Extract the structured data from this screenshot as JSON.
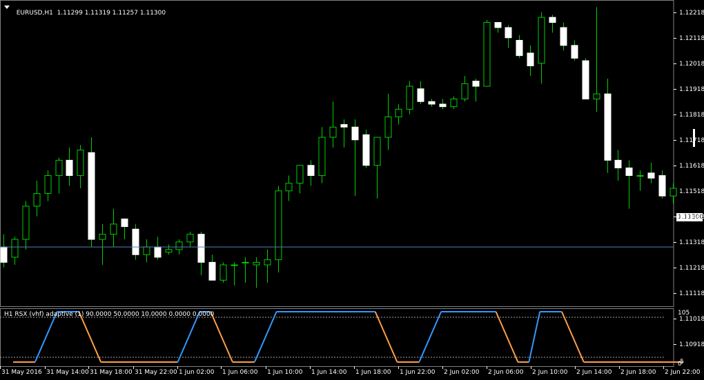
{
  "header": {
    "symbol": "EURUSD,H1",
    "open": "1.11299",
    "high": "1.11319",
    "low": "1.11257",
    "close": "1.11300"
  },
  "indicator": {
    "label": "H1 RSX (vhf) adaptive (1) 90.0000 50.0000 10.0000 0.0000 0.0000",
    "level_top": "105",
    "level_bottom": "0",
    "level_bottom2": "-5",
    "up_color": "#3399ff",
    "down_color": "#ff9f4a"
  },
  "current_price": "1.11300",
  "colors": {
    "background": "#000000",
    "candle_wick": "#00d000",
    "bull_body": "#000000",
    "bear_body": "#ffffff",
    "price_line": "#4a7fb8",
    "separator": "#808080"
  },
  "chart_data": {
    "type": "candlestick",
    "title": "EURUSD,H1",
    "ylim": [
      1.11068,
      1.12268
    ],
    "price_axis_labels": [
      "1.12218",
      "1.12118",
      "1.12018",
      "1.11918",
      "1.11818",
      "1.11718",
      "1.11618",
      "1.11518",
      "1.11418",
      "1.11318",
      "1.11218",
      "1.11118",
      "1.11018",
      "1.10918"
    ],
    "time_axis_labels": [
      "31 May 2016",
      "31 May 14:00",
      "31 May 18:00",
      "31 May 22:00",
      "1 Jun 02:00",
      "1 Jun 06:00",
      "1 Jun 10:00",
      "1 Jun 14:00",
      "1 Jun 18:00",
      "1 Jun 22:00",
      "2 Jun 02:00",
      "2 Jun 06:00",
      "2 Jun 10:00",
      "2 Jun 14:00",
      "2 Jun 18:00",
      "2 Jun 22:00"
    ],
    "candles": [
      [
        1.113,
        1.1135,
        1.1122,
        1.1124
      ],
      [
        1.1126,
        1.1134,
        1.1123,
        1.1133
      ],
      [
        1.1133,
        1.1148,
        1.1129,
        1.1146
      ],
      [
        1.1146,
        1.1156,
        1.1142,
        1.1151
      ],
      [
        1.1151,
        1.116,
        1.1148,
        1.1158
      ],
      [
        1.1158,
        1.1165,
        1.1151,
        1.1164
      ],
      [
        1.1164,
        1.1169,
        1.1154,
        1.1158
      ],
      [
        1.1158,
        1.117,
        1.1153,
        1.1168
      ],
      [
        1.1167,
        1.1173,
        1.113,
        1.1133
      ],
      [
        1.1133,
        1.1139,
        1.1123,
        1.1135
      ],
      [
        1.1135,
        1.1145,
        1.113,
        1.1139
      ],
      [
        1.1141,
        1.1141,
        1.1133,
        1.1138
      ],
      [
        1.1137,
        1.1139,
        1.1125,
        1.1127
      ],
      [
        1.1127,
        1.1133,
        1.1124,
        1.113
      ],
      [
        1.113,
        1.1134,
        1.1125,
        1.1126
      ],
      [
        1.1128,
        1.1131,
        1.1127,
        1.1129
      ],
      [
        1.1129,
        1.1133,
        1.1127,
        1.1132
      ],
      [
        1.1132,
        1.1136,
        1.113,
        1.1135
      ],
      [
        1.1135,
        1.1136,
        1.1119,
        1.1124
      ],
      [
        1.1124,
        1.1127,
        1.1118,
        1.1117
      ],
      [
        1.1117,
        1.1124,
        1.1116,
        1.1123
      ],
      [
        1.1123,
        1.1124,
        1.1115,
        1.1123
      ],
      [
        1.1124,
        1.1126,
        1.1116,
        1.1124
      ],
      [
        1.1123,
        1.1126,
        1.1114,
        1.1124
      ],
      [
        1.1123,
        1.1129,
        1.1116,
        1.1125
      ],
      [
        1.1125,
        1.1154,
        1.112,
        1.1152
      ],
      [
        1.1152,
        1.1158,
        1.1148,
        1.1155
      ],
      [
        1.1155,
        1.1162,
        1.1151,
        1.1162
      ],
      [
        1.1162,
        1.1164,
        1.1154,
        1.1158
      ],
      [
        1.1158,
        1.1177,
        1.1155,
        1.1173
      ],
      [
        1.1173,
        1.1187,
        1.1169,
        1.1177
      ],
      [
        1.1178,
        1.118,
        1.1169,
        1.1177
      ],
      [
        1.1177,
        1.118,
        1.115,
        1.1172
      ],
      [
        1.1174,
        1.1176,
        1.1161,
        1.1162
      ],
      [
        1.1162,
        1.1172,
        1.1149,
        1.1173
      ],
      [
        1.1173,
        1.119,
        1.1168,
        1.1181
      ],
      [
        1.1181,
        1.1186,
        1.1178,
        1.1184
      ],
      [
        1.1184,
        1.1195,
        1.1182,
        1.1193
      ],
      [
        1.1192,
        1.1195,
        1.1186,
        1.1187
      ],
      [
        1.1187,
        1.1188,
        1.1185,
        1.1186
      ],
      [
        1.1186,
        1.1188,
        1.1184,
        1.1185
      ],
      [
        1.1185,
        1.1189,
        1.1184,
        1.1188
      ],
      [
        1.1188,
        1.1197,
        1.1187,
        1.1194
      ],
      [
        1.1195,
        1.1196,
        1.1187,
        1.1193
      ],
      [
        1.1193,
        1.1219,
        1.1193,
        1.1218
      ],
      [
        1.1218,
        1.1218,
        1.1214,
        1.1216
      ],
      [
        1.1216,
        1.1217,
        1.1208,
        1.1212
      ],
      [
        1.1211,
        1.1213,
        1.1204,
        1.1205
      ],
      [
        1.1206,
        1.1209,
        1.1197,
        1.1201
      ],
      [
        1.1202,
        1.1222,
        1.1194,
        1.122
      ],
      [
        1.122,
        1.1221,
        1.1214,
        1.1218
      ],
      [
        1.1216,
        1.1218,
        1.1207,
        1.1209
      ],
      [
        1.1209,
        1.1211,
        1.1203,
        1.1204
      ],
      [
        1.1203,
        1.1204,
        1.1188,
        1.1188
      ],
      [
        1.1188,
        1.1224,
        1.1183,
        1.119
      ],
      [
        1.119,
        1.1196,
        1.1159,
        1.1164
      ],
      [
        1.1164,
        1.1168,
        1.1156,
        1.1161
      ],
      [
        1.1161,
        1.1164,
        1.1145,
        1.1158
      ],
      [
        1.1158,
        1.116,
        1.1152,
        1.1158
      ],
      [
        1.1159,
        1.1163,
        1.1155,
        1.1157
      ],
      [
        1.1158,
        1.116,
        1.1149,
        1.115
      ],
      [
        1.115,
        1.1155,
        1.1147,
        1.1153
      ]
    ],
    "rsx_line": [
      [
        0,
        0
      ],
      [
        2,
        0
      ],
      [
        4,
        100
      ],
      [
        6,
        100
      ],
      [
        8,
        0
      ],
      [
        15,
        0
      ],
      [
        17,
        100
      ],
      [
        18,
        100
      ],
      [
        20,
        0
      ],
      [
        22,
        0
      ],
      [
        24,
        100
      ],
      [
        33,
        100
      ],
      [
        35,
        0
      ],
      [
        37,
        0
      ],
      [
        39,
        100
      ],
      [
        44,
        100
      ],
      [
        46,
        0
      ],
      [
        47,
        0
      ],
      [
        48,
        100
      ],
      [
        50,
        100
      ],
      [
        52,
        0
      ],
      [
        61,
        0
      ]
    ],
    "rsx_up_segments": [
      [
        2,
        4
      ],
      [
        15,
        17
      ],
      [
        22,
        24
      ],
      [
        37,
        39
      ],
      [
        47,
        48
      ]
    ],
    "rsx_down_segments": [
      [
        6,
        8
      ],
      [
        18,
        20
      ],
      [
        33,
        35
      ],
      [
        44,
        46
      ],
      [
        50,
        52
      ]
    ],
    "rsx_flat_top": [
      [
        4,
        6
      ],
      [
        17,
        18
      ],
      [
        24,
        33
      ],
      [
        39,
        44
      ],
      [
        48,
        50
      ]
    ],
    "rsx_flat_bottom": [
      [
        0,
        2
      ],
      [
        8,
        15
      ],
      [
        20,
        22
      ],
      [
        35,
        37
      ],
      [
        46,
        47
      ],
      [
        52,
        61
      ]
    ]
  }
}
